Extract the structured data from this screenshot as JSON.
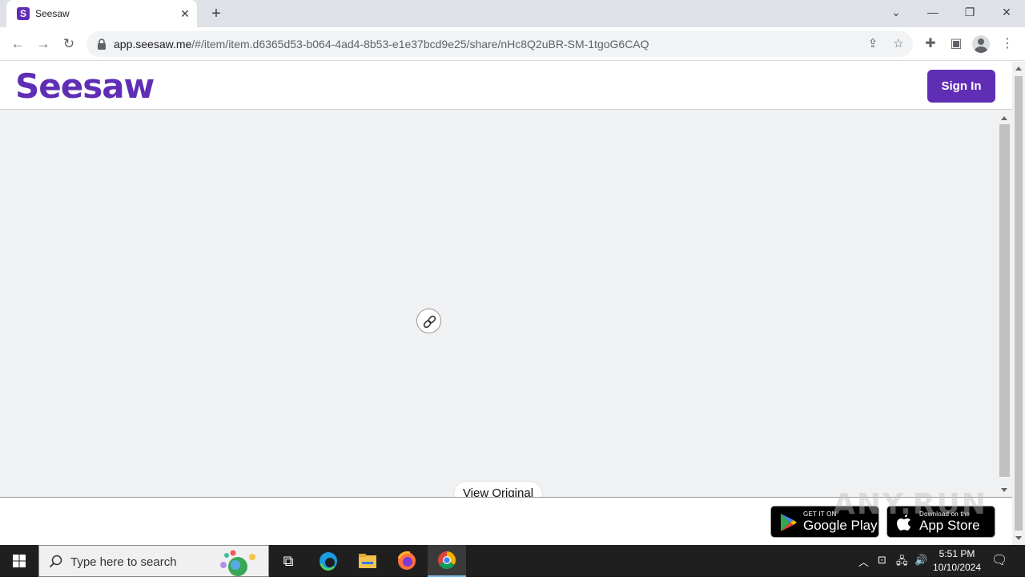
{
  "browser": {
    "tab_title": "Seesaw",
    "tab_favicon": "S",
    "url_host": "app.seesaw.me",
    "url_path": "/#/item/item.d6365d53-b064-4ad4-8b53-e1e37bcd9e25/share/nHc8Q2uBR-SM-1tgoG6CAQ"
  },
  "header": {
    "logo": "Seesaw",
    "signin_label": "Sign In"
  },
  "content": {
    "view_original_label": "View Original",
    "link_icon": "link-icon"
  },
  "footer": {
    "google_play_small": "GET IT ON",
    "google_play_big": "Google Play",
    "app_store_small": "Download on the",
    "app_store_big": "App Store"
  },
  "watermark": "ANY.RUN",
  "taskbar": {
    "search_placeholder": "Type here to search",
    "time": "5:51 PM",
    "date": "10/10/2024"
  },
  "colors": {
    "brand": "#5f2eb5",
    "content_bg": "#f0f1f3"
  }
}
